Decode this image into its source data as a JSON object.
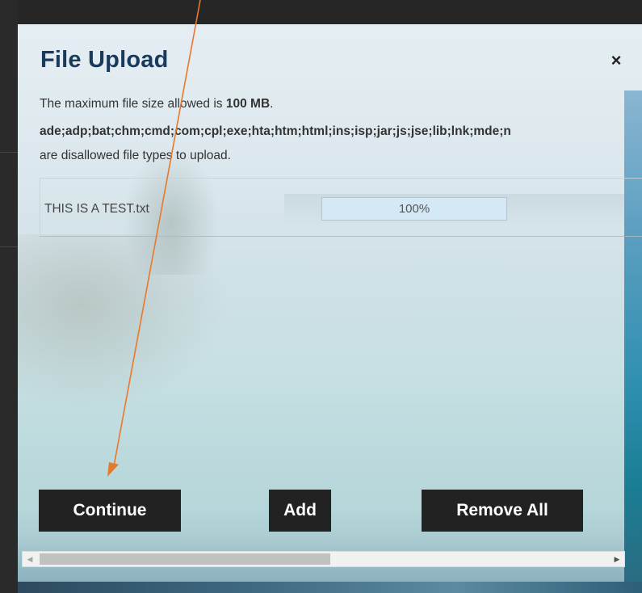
{
  "dialog": {
    "title": "File Upload",
    "close_label": "×",
    "max_size_prefix": "The maximum file size allowed is ",
    "max_size_value": "100 MB",
    "max_size_suffix": ".",
    "disallowed_types": "ade;adp;bat;chm;cmd;com;cpl;exe;hta;htm;html;ins;isp;jar;js;jse;lib;lnk;mde;n",
    "disallowed_note": "are disallowed file types to upload."
  },
  "files": [
    {
      "name": "THIS IS A TEST.txt",
      "progress_text": "100%",
      "progress": 1.0
    }
  ],
  "buttons": {
    "continue": "Continue",
    "add": "Add",
    "remove_all": "Remove All"
  },
  "scrollbar": {
    "left_arrow": "◀",
    "right_arrow": "▶",
    "position": 0.0
  },
  "colors": {
    "title": "#1a3a5c",
    "button_bg": "#222222",
    "annotation_arrow": "#e8782a",
    "progress_fill": "#d5e8f5"
  }
}
